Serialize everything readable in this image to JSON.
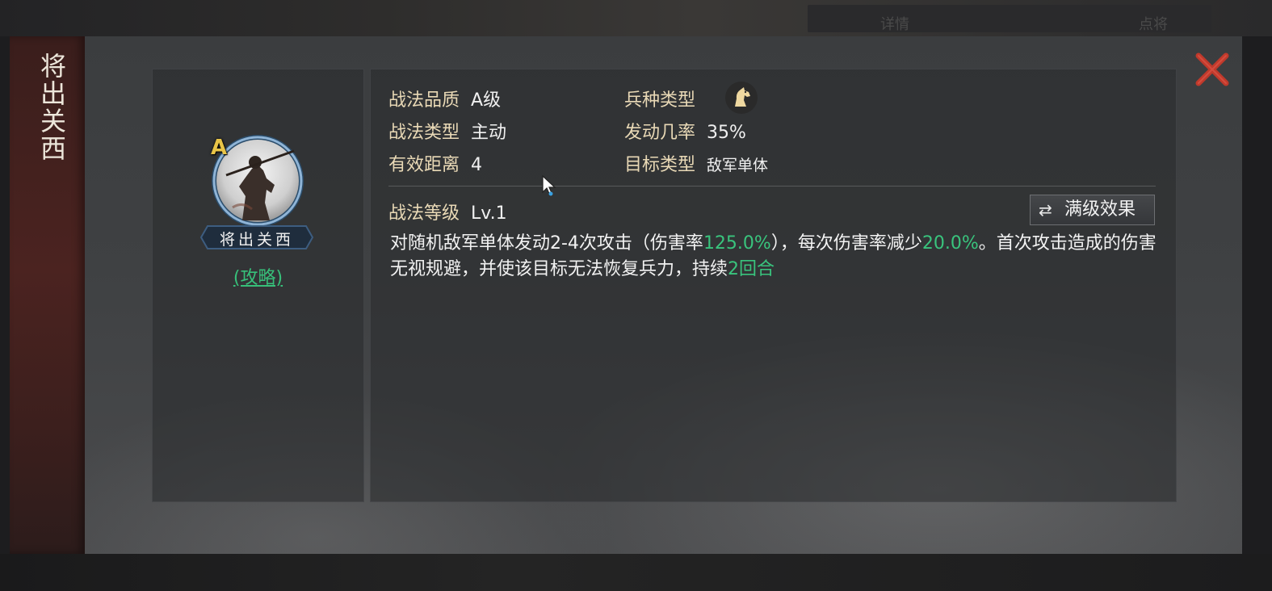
{
  "title": "将出关西",
  "skill": {
    "grade_badge": "A",
    "name": "将出关西",
    "guide_link": "(攻略)"
  },
  "info": {
    "quality_label": "战法品质",
    "quality_value": "A级",
    "troop_label": "兵种类型",
    "troop_icon": "horse-icon",
    "type_label": "战法类型",
    "type_value": "主动",
    "rate_label": "发动几率",
    "rate_value": "35%",
    "range_label": "有效距离",
    "range_value": "4",
    "target_label": "目标类型",
    "target_value": "敌军单体",
    "level_label": "战法等级",
    "level_value": "Lv.1",
    "max_button": "满级效果"
  },
  "description": {
    "p1": "对随机敌军单体发动2-4次攻击（伤害率",
    "v1": "125.0%",
    "p2": "），每次伤害率减少",
    "v2": "20.0%",
    "p3": "。首次攻击造成的伤害无视规避，并使该目标无法恢复兵力，持续",
    "v3": "2回合"
  },
  "colors": {
    "highlight_green": "#39c47d",
    "grade_gold": "#e8c447",
    "close_red": "#c0392b",
    "label_tan": "#e9d9b6"
  },
  "background": {
    "ghost_tab_1": "详情",
    "ghost_tab_2": "点将"
  }
}
